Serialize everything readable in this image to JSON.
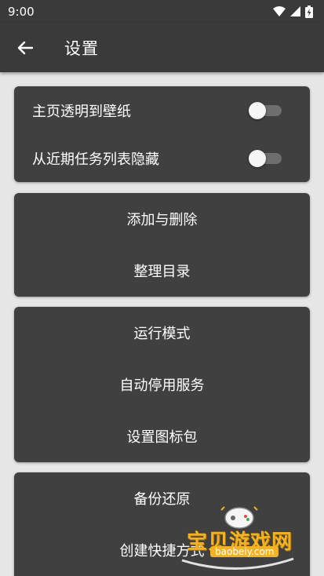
{
  "status_bar": {
    "time": "9:00"
  },
  "app_bar": {
    "title": "设置"
  },
  "settings": {
    "toggles": [
      {
        "label": "主页透明到壁纸",
        "on": false
      },
      {
        "label": "从近期任务列表隐藏",
        "on": false
      }
    ],
    "group_edit": [
      "添加与删除",
      "整理目录"
    ],
    "group_service": [
      "运行模式",
      "自动停用服务",
      "设置图标包"
    ],
    "group_backup": [
      "备份还原",
      "创建快捷方式"
    ]
  },
  "watermark": {
    "brand": "宝贝游戏网",
    "url": "baobeiy.com"
  },
  "colors": {
    "bar": "#3a3a3a",
    "card": "#404040",
    "background": "#e6e6e6",
    "watermark": "#f3b224"
  }
}
